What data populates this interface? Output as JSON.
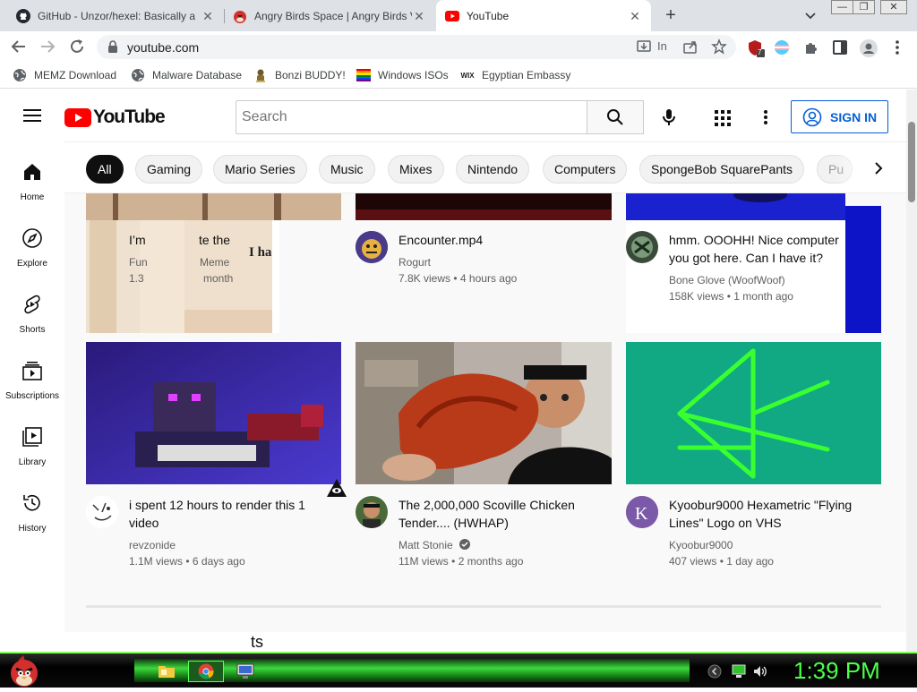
{
  "browser": {
    "tabs": [
      {
        "label": "GitHub - Unzor/hexel: Basically a",
        "active": false
      },
      {
        "label": "Angry Birds Space | Angry Birds V",
        "active": false
      },
      {
        "label": "YouTube",
        "active": true
      }
    ],
    "new_tab_symbol": "+",
    "url": "youtube.com",
    "omnibox_extra": "In",
    "extension_badge": "7",
    "window_buttons": [
      "—",
      "❐",
      "✕"
    ]
  },
  "bookmarks": [
    {
      "label": "MEMZ Download",
      "icon": "globe-icon"
    },
    {
      "label": "Malware Database",
      "icon": "globe-icon"
    },
    {
      "label": "Bonzi BUDDY!",
      "icon": "bonzi-icon"
    },
    {
      "label": "Windows ISOs",
      "icon": "rainbow-flag-icon"
    },
    {
      "label": "Egyptian Embassy",
      "icon": "wix-icon"
    }
  ],
  "youtube": {
    "logo_text": "YouTube",
    "search_placeholder": "Search",
    "signin_label": "SIGN IN",
    "chips": [
      "All",
      "Gaming",
      "Mario Series",
      "Music",
      "Mixes",
      "Nintendo",
      "Computers",
      "SpongeBob SquarePants",
      "Pu"
    ],
    "sidebar": [
      {
        "label": "Home",
        "icon": "home-icon"
      },
      {
        "label": "Explore",
        "icon": "compass-icon"
      },
      {
        "label": "Shorts",
        "icon": "shorts-icon"
      },
      {
        "label": "Subscriptions",
        "icon": "subscriptions-icon"
      },
      {
        "label": "Library",
        "icon": "library-icon"
      },
      {
        "label": "History",
        "icon": "history-icon"
      }
    ],
    "videos_row1": [
      {
        "title": "I’m",
        "title_tail": "te the",
        "channel": "Fun",
        "channel_tail": "Meme",
        "views": "1.3",
        "age_tail": "month",
        "overlay_text": "I ha"
      },
      {
        "title": "Encounter.mp4",
        "channel": "Rogurt",
        "views": "7.8K views",
        "age": "4 hours ago"
      },
      {
        "title": "hmm. OOOHH! Nice computer you got here. Can I have it?",
        "channel": "Bone Glove (WoofWoof)",
        "views": "158K views",
        "age": "1 month ago"
      }
    ],
    "videos_row2": [
      {
        "title": "i spent 12 hours to render this 1 video",
        "channel": "revzonide",
        "views": "1.1M views",
        "age": "6 days ago"
      },
      {
        "title": "The 2,000,000 Scoville Chicken Tender.... (HWHAP)",
        "channel": "Matt Stonie",
        "verified": true,
        "views": "11M views",
        "age": "2 months ago"
      },
      {
        "title": "Kyoobur9000 Hexametric \"Flying Lines\" Logo on VHS",
        "channel": "Kyoobur9000",
        "views": "407 views",
        "age": "1 day ago"
      }
    ],
    "meta_separator": "•",
    "stray_text": "ts"
  },
  "taskbar": {
    "clock": "1:39 PM"
  },
  "colors": {
    "youtube_red": "#ff0000",
    "signin_blue": "#065fd4",
    "taskbar_green": "#3ed83e",
    "clock_green": "#4cff4c"
  }
}
